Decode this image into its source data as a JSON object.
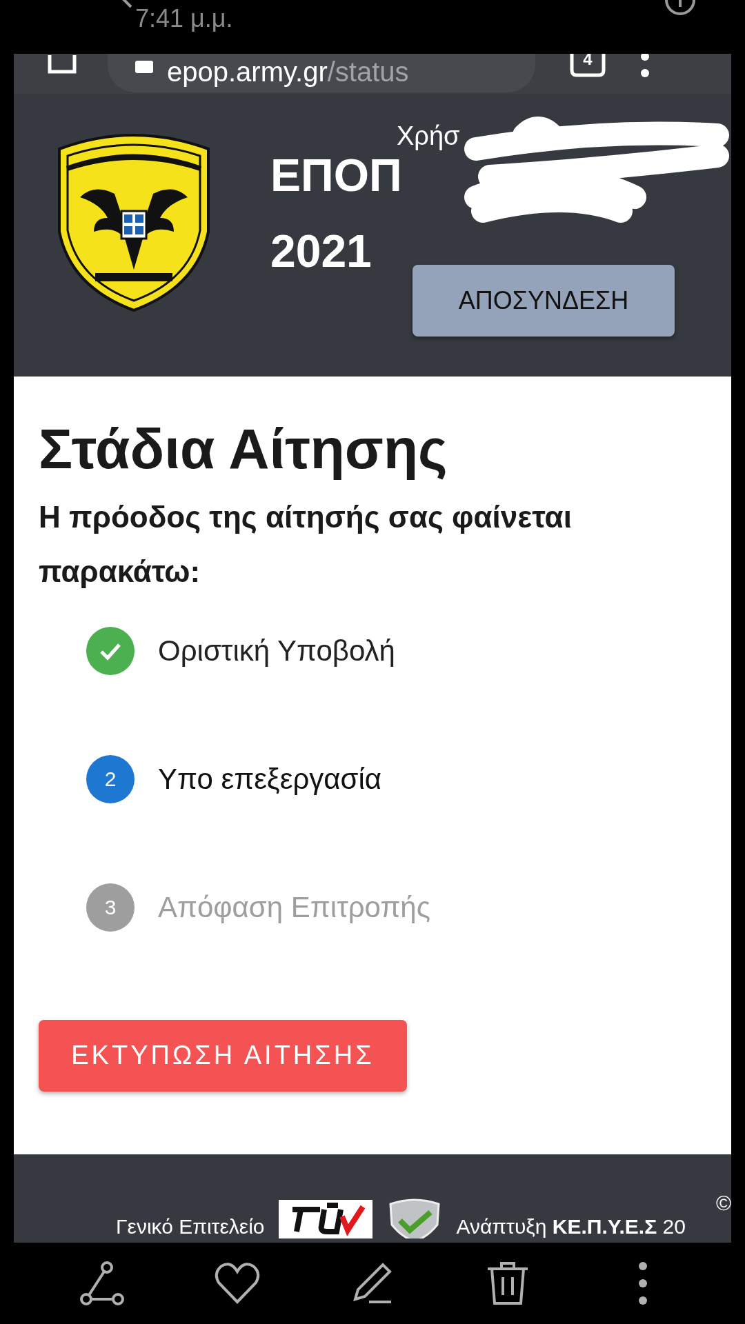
{
  "status_bar": {
    "time": "7:41 μ.μ."
  },
  "browser": {
    "url_host": "epop.army.gr",
    "url_path": "/status",
    "tab_count": "4"
  },
  "header": {
    "user_label": "Χρήσ",
    "title": "ΕΠΟΠ",
    "year": "2021",
    "logout_button": "ΑΠΟΣΥΝΔΕΣΗ"
  },
  "content": {
    "heading": "Στάδια Αίτησης",
    "subtitle": "Η πρόοδος της αίτησής σας φαίνεται παρακάτω:",
    "steps": [
      {
        "completed": true,
        "current": false,
        "label": "Οριστική Υποβολή"
      },
      {
        "completed": false,
        "current": true,
        "number": "2",
        "label": "Υπο επεξεργασία"
      },
      {
        "completed": false,
        "current": false,
        "number": "3",
        "label": "Απόφαση Επιτροπής"
      }
    ],
    "print_button": "ΕΚΤΥΠΩΣΗ ΑΙΤΗΣΗΣ"
  },
  "footer": {
    "left_text": "Γενικό Επιτελείο",
    "right_text": "Ανάπτυξη **ΚΕ.Π.Υ.Ε.Σ** 20",
    "copyright": "©"
  }
}
